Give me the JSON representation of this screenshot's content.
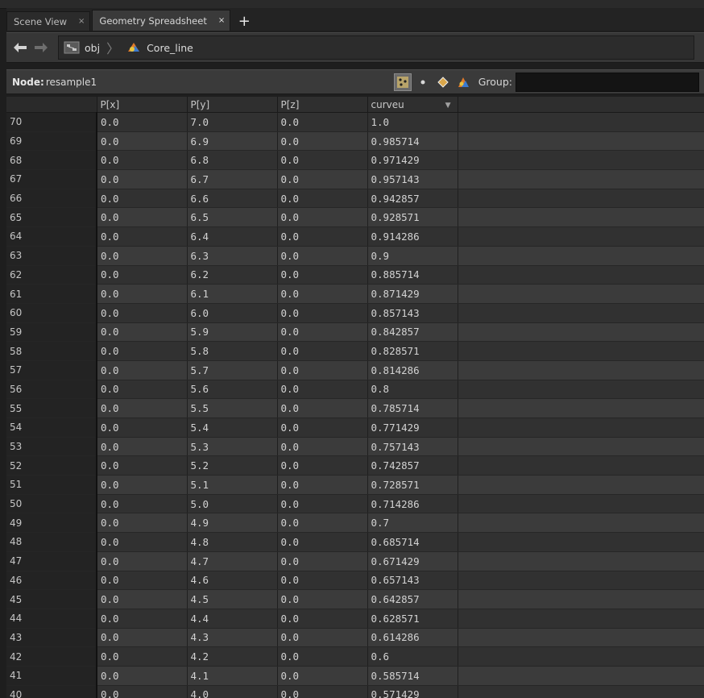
{
  "tabs": [
    {
      "label": "Scene View",
      "close": "×"
    },
    {
      "label": "Geometry Spreadsheet",
      "close": "×"
    }
  ],
  "new_tab": "+",
  "path": {
    "crumbs": [
      "obj",
      "Core_line"
    ],
    "icons": [
      "back-arrow-icon",
      "forward-arrow-icon",
      "network-icon",
      "object-node-icon"
    ]
  },
  "node": {
    "label": "Node:",
    "name": "resample1"
  },
  "group": {
    "label": "Group:",
    "value": ""
  },
  "columns": [
    "",
    "P[x]",
    "P[y]",
    "P[z]",
    "curveu"
  ],
  "rows": [
    [
      "70",
      "0.0",
      "7.0",
      "0.0",
      "1.0"
    ],
    [
      "69",
      "0.0",
      "6.9",
      "0.0",
      "0.985714"
    ],
    [
      "68",
      "0.0",
      "6.8",
      "0.0",
      "0.971429"
    ],
    [
      "67",
      "0.0",
      "6.7",
      "0.0",
      "0.957143"
    ],
    [
      "66",
      "0.0",
      "6.6",
      "0.0",
      "0.942857"
    ],
    [
      "65",
      "0.0",
      "6.5",
      "0.0",
      "0.928571"
    ],
    [
      "64",
      "0.0",
      "6.4",
      "0.0",
      "0.914286"
    ],
    [
      "63",
      "0.0",
      "6.3",
      "0.0",
      "0.9"
    ],
    [
      "62",
      "0.0",
      "6.2",
      "0.0",
      "0.885714"
    ],
    [
      "61",
      "0.0",
      "6.1",
      "0.0",
      "0.871429"
    ],
    [
      "60",
      "0.0",
      "6.0",
      "0.0",
      "0.857143"
    ],
    [
      "59",
      "0.0",
      "5.9",
      "0.0",
      "0.842857"
    ],
    [
      "58",
      "0.0",
      "5.8",
      "0.0",
      "0.828571"
    ],
    [
      "57",
      "0.0",
      "5.7",
      "0.0",
      "0.814286"
    ],
    [
      "56",
      "0.0",
      "5.6",
      "0.0",
      "0.8"
    ],
    [
      "55",
      "0.0",
      "5.5",
      "0.0",
      "0.785714"
    ],
    [
      "54",
      "0.0",
      "5.4",
      "0.0",
      "0.771429"
    ],
    [
      "53",
      "0.0",
      "5.3",
      "0.0",
      "0.757143"
    ],
    [
      "52",
      "0.0",
      "5.2",
      "0.0",
      "0.742857"
    ],
    [
      "51",
      "0.0",
      "5.1",
      "0.0",
      "0.728571"
    ],
    [
      "50",
      "0.0",
      "5.0",
      "0.0",
      "0.714286"
    ],
    [
      "49",
      "0.0",
      "4.9",
      "0.0",
      "0.7"
    ],
    [
      "48",
      "0.0",
      "4.8",
      "0.0",
      "0.685714"
    ],
    [
      "47",
      "0.0",
      "4.7",
      "0.0",
      "0.671429"
    ],
    [
      "46",
      "0.0",
      "4.6",
      "0.0",
      "0.657143"
    ],
    [
      "45",
      "0.0",
      "4.5",
      "0.0",
      "0.642857"
    ],
    [
      "44",
      "0.0",
      "4.4",
      "0.0",
      "0.628571"
    ],
    [
      "43",
      "0.0",
      "4.3",
      "0.0",
      "0.614286"
    ],
    [
      "42",
      "0.0",
      "4.2",
      "0.0",
      "0.6"
    ],
    [
      "41",
      "0.0",
      "4.1",
      "0.0",
      "0.585714"
    ],
    [
      "40",
      "0.0",
      "4.0",
      "0.0",
      "0.571429"
    ]
  ]
}
